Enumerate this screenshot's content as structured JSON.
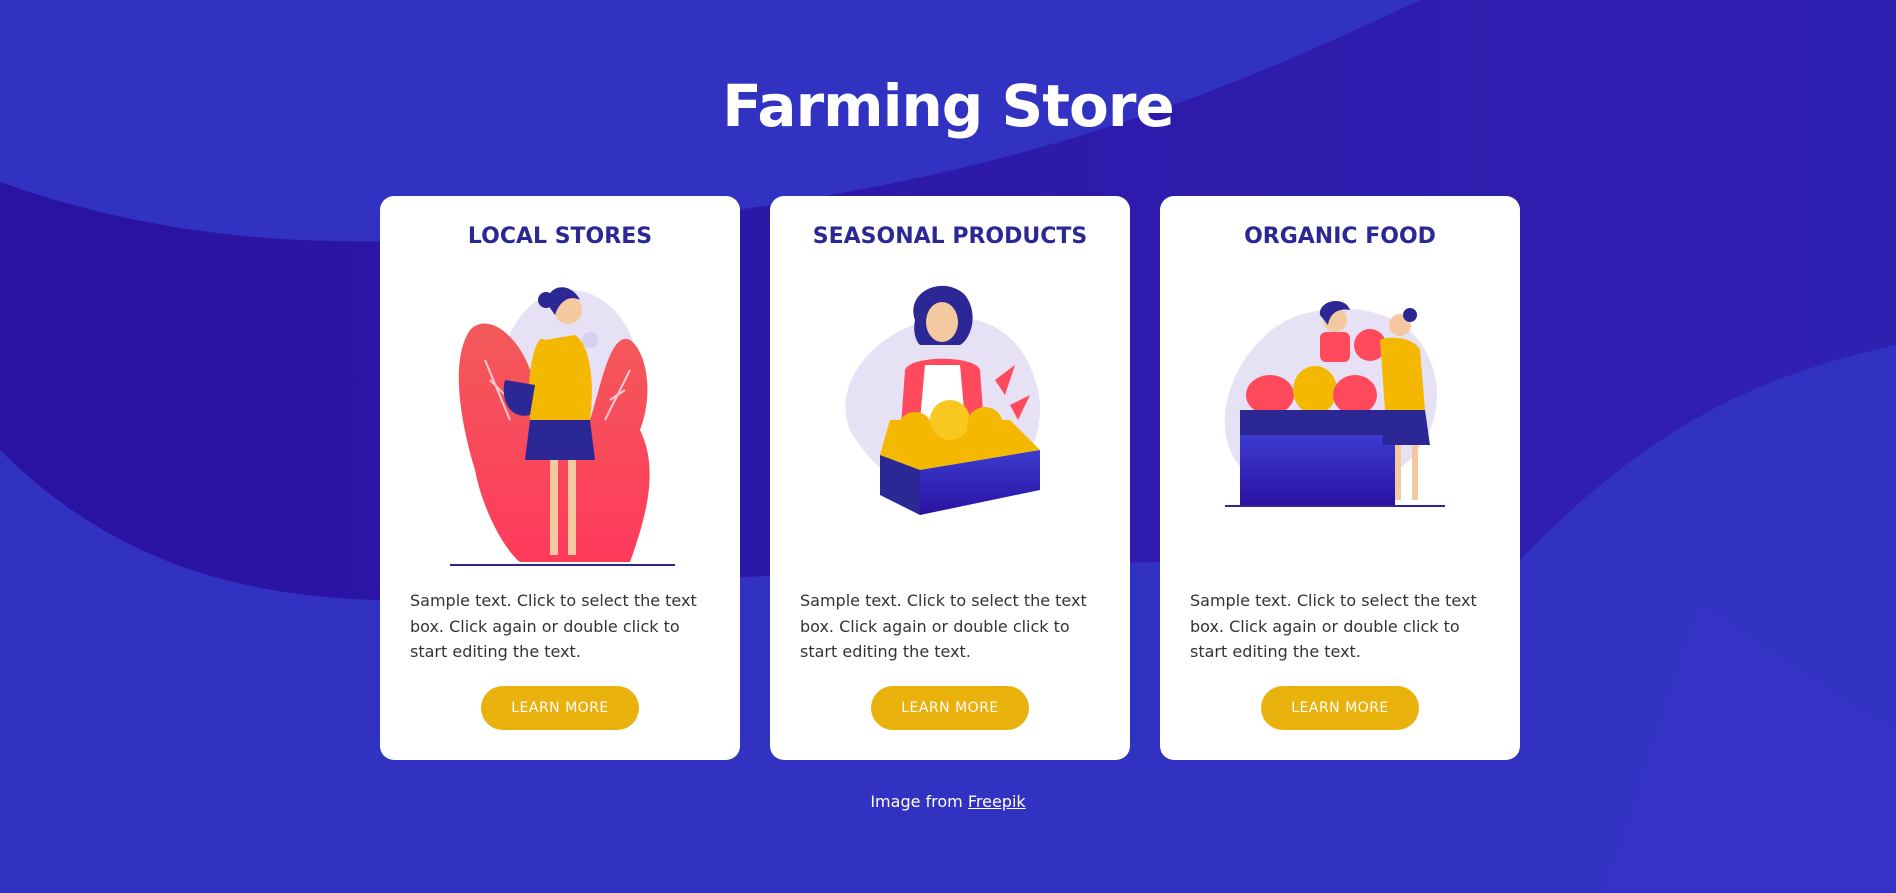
{
  "page": {
    "title": "Farming Store"
  },
  "colors": {
    "background": "#3232c2",
    "accent": "#e8b10c",
    "card_title": "#2b2896"
  },
  "cards": [
    {
      "title": "LOCAL STORES",
      "illustration": "woman-shopping-icon",
      "text": "Sample text. Click to select the text box. Click again or double click to start editing the text.",
      "button": "LEARN MORE"
    },
    {
      "title": "SEASONAL PRODUCTS",
      "illustration": "farmer-with-box-icon",
      "text": "Sample text. Click to select the text box. Click again or double click to start editing the text.",
      "button": "LEARN MORE"
    },
    {
      "title": "ORGANIC FOOD",
      "illustration": "market-stall-icon",
      "text": "Sample text. Click to select the text box. Click again or double click to start editing the text.",
      "button": "LEARN MORE"
    }
  ],
  "credit": {
    "prefix": "Image from ",
    "link": "Freepik"
  }
}
